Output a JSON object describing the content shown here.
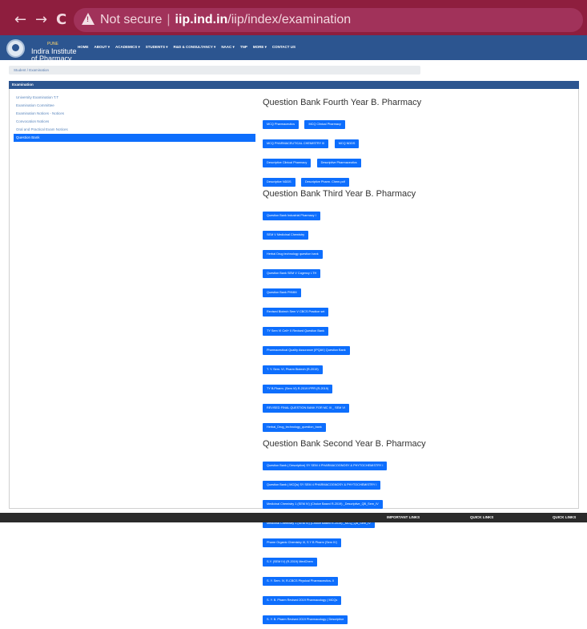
{
  "browser": {
    "not_secure": "Not secure",
    "separator": "|",
    "host": "iip.ind.in",
    "path": "/iip/index/examination",
    "back_glyph": "←",
    "forward_glyph": "→",
    "reload_glyph": "C"
  },
  "header": {
    "brand_pre": "PUNE",
    "brand_lines": [
      "Indira Institute",
      "of Pharmacy,",
      "Sadavali."
    ],
    "menu": [
      "HOME",
      "ABOUT ▾",
      "ACADEMICS ▾",
      "STUDENTS ▾",
      "R&D & CONSULTANCY ▾",
      "NAAC ▾",
      "TNP",
      "MORE ▾",
      "CONTACT US"
    ]
  },
  "breadcrumb": "Student / Examination",
  "panel_title": "Examination",
  "sidebar": [
    "University Examination T.T",
    "Examination Committee",
    "Examination Notices - Notices",
    "Convocation Notices",
    "Oral and Practical Exam Notices",
    "Question Bank"
  ],
  "sections": [
    {
      "heading": "Question Bank Fourth Year B. Pharmacy",
      "rows": [
        [
          "MCQ Pharmaceutics",
          "MCQ Clinical Pharmacy"
        ],
        [
          "MCQ PHARMACEUTICAL CHEMISTRY III",
          "MCQ NDDS"
        ],
        [
          "Descriptive Clinical Pharmacy",
          "Descriptive Pharmaceutics"
        ],
        [
          "Descriptive NDDS",
          "Descriptive Pharm. Chem.pdf"
        ]
      ]
    },
    {
      "heading": "Question Bank Third Year B. Pharmacy",
      "rows": [
        [
          "Question Bank Industrial Pharmacy I"
        ],
        [
          "SEM V Medicinal Chemistry"
        ],
        [
          "Herbal Drug technology question bank"
        ],
        [
          "Question Bank SEM V Cogency I-TH"
        ],
        [
          "Question Bank PHMM"
        ],
        [
          "Revised Biotech Sem V CBCS Practice set"
        ],
        [
          "TY Sem VI Cell+ II Revised Question Bank"
        ],
        [
          "Pharmaceutical Quality Assurance (IPQAV) Question Bank"
        ],
        [
          "T. Y. Sem. VI, Pharm Biotech (R-2019)"
        ],
        [
          "TY B.Pharm. (Sem VI) R-2019 IPPR (R-2019)"
        ],
        [
          "REVISED FINAL QUESTION BANK FOR MC III _ SEM VI"
        ],
        [
          "Herbal_Drug_technology_question_bank"
        ]
      ]
    },
    {
      "heading": "Question Bank Second Year B. Pharmacy",
      "rows": [
        [
          "Question Bank ( Descriptive) SY SEM 4 PHARMACOGNOSY & PHYTOCHEMISTRY I"
        ],
        [
          "Question Bank ( MCQs) SY SEM 4 PHARMACOGNOSY & PHYTOCHEMISTRY I"
        ],
        [
          "Medicinal Chemistry 1 (SEM IV) (Choice Based R-2019) _Descriptive_QB_Sem_IV"
        ],
        [
          "Medicinal Chemistry 1 (SEM IV) (Choice Based R-2019) _MCQ_QB_Sem_IV"
        ],
        [
          "Pharm Organic Chemistry III, S Y B Pharm (Sem IV)"
        ],
        [
          "S.Y. (SEM IV) (R-2019) MedChem"
        ],
        [
          "S. Y. Sem. IV, R-CBCS Physical Pharmaceutics- II"
        ],
        [
          "S. Y. B. Pharm Revised 2019 Pharmacology ( MCQs"
        ],
        [
          "S. Y. B. Pharm Revised 2019 Pharmacology ( Descriptive"
        ]
      ]
    }
  ],
  "footer": [
    "IMPORTANT LINKS",
    "QUICK LINKS",
    "QUICK LINKS"
  ]
}
